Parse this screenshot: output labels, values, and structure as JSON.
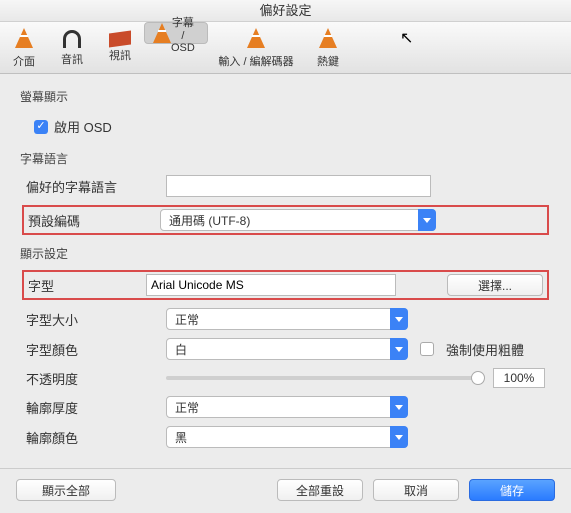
{
  "window": {
    "title": "偏好設定"
  },
  "tabs": {
    "interface": "介面",
    "audio": "音訊",
    "video": "視訊",
    "subtitle": "字幕 / OSD",
    "input": "輸入 / 編解碼器",
    "hotkeys": "熱鍵"
  },
  "osd": {
    "section": "螢幕顯示",
    "enable": "啟用 OSD"
  },
  "sub_lang": {
    "section": "字幕語言",
    "pref_lang": "偏好的字幕語言",
    "pref_lang_value": "",
    "encoding_label": "預設編碼",
    "encoding_value": "通用碼 (UTF-8)"
  },
  "disp": {
    "section": "顯示設定",
    "font_label": "字型",
    "font_value": "Arial Unicode MS",
    "choose": "選擇...",
    "size_label": "字型大小",
    "size_value": "正常",
    "color_label": "字型顏色",
    "color_value": "白",
    "force_bold": "強制使用粗體",
    "opacity_label": "不透明度",
    "opacity_value": "100%",
    "outline_th_label": "輪廓厚度",
    "outline_th_value": "正常",
    "outline_color_label": "輪廓顏色",
    "outline_color_value": "黑"
  },
  "buttons": {
    "show_all": "顯示全部",
    "reset": "全部重設",
    "cancel": "取消",
    "save": "儲存"
  }
}
